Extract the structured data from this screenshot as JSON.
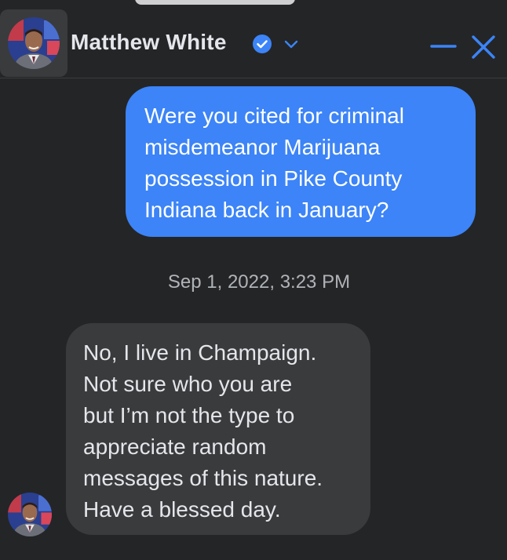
{
  "contact": {
    "name": "Matthew White",
    "verified": true,
    "avatar_icon": "profile-photo"
  },
  "header": {
    "verified_icon": "verified-badge-icon",
    "options_icon": "chevron-down-icon",
    "minimize_icon": "minimize-icon",
    "close_icon": "close-icon"
  },
  "messages": [
    {
      "direction": "outgoing",
      "text": "Were you cited for criminal\nmisdemeanor Marijuana\npossession in Pike County\nIndiana back in January?"
    },
    {
      "direction": "incoming",
      "text": "No, I live in Champaign.\nNot sure who you are\nbut I’m not the type to\nappreciate random\nmessages of this nature.\nHave a blessed day."
    }
  ],
  "timestamp": "Sep 1, 2022, 3:23 PM",
  "colors": {
    "background": "#242526",
    "outgoing_bubble": "#3c84f7",
    "incoming_bubble": "#3a3b3c",
    "accent": "#3c84f7",
    "text_primary": "#e4e6eb",
    "text_secondary": "#b0b3b8"
  }
}
